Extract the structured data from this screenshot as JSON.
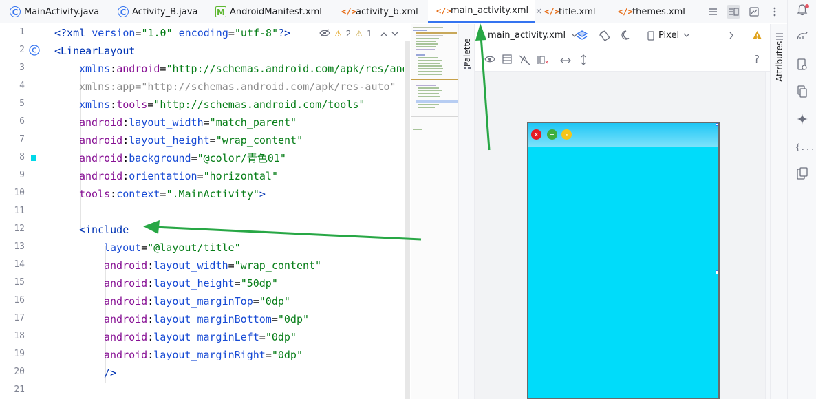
{
  "tabs": [
    {
      "label": "MainActivity.java",
      "icon": "java-class-icon"
    },
    {
      "label": "Activity_B.java",
      "icon": "java-class-icon"
    },
    {
      "label": "AndroidManifest.xml",
      "icon": "manifest-icon"
    },
    {
      "label": "activity_b.xml",
      "icon": "xml-file-icon"
    },
    {
      "label": "main_activity.xml",
      "icon": "xml-file-icon",
      "active": true
    },
    {
      "label": "title.xml",
      "icon": "xml-file-icon"
    },
    {
      "label": "themes.xml",
      "icon": "xml-file-icon"
    }
  ],
  "active_tab_close": "×",
  "inspection": {
    "warnings": "2",
    "weak_warnings": "1"
  },
  "line_numbers": [
    "1",
    "2",
    "3",
    "4",
    "5",
    "6",
    "7",
    "8",
    "9",
    "10",
    "11",
    "12",
    "13",
    "14",
    "15",
    "16",
    "17",
    "18",
    "19",
    "20",
    "21"
  ],
  "code": {
    "l1": {
      "a": "<?xml ",
      "b": "version",
      "c": "=",
      "d": "\"1.0\"",
      "e": " encoding",
      "f": "=",
      "g": "\"utf-8\"",
      "h": "?>"
    },
    "l2": {
      "a": "<LinearLayout"
    },
    "l3": {
      "ns": "xmlns",
      "c": ":",
      "attr": "android",
      "eq": "=",
      "val": "\"http://schemas.android.com/apk/res/andr"
    },
    "l4": {
      "ns": "xmlns",
      "c": ":",
      "attr": "app",
      "eq": "=",
      "val": "\"http://schemas.android.com/apk/res-auto\""
    },
    "l5": {
      "ns": "xmlns",
      "c": ":",
      "attr": "tools",
      "eq": "=",
      "val": "\"http://schemas.android.com/tools\""
    },
    "l6": {
      "ns": "android",
      "c": ":",
      "attr": "layout_width",
      "eq": "=",
      "val": "\"match_parent\""
    },
    "l7": {
      "ns": "android",
      "c": ":",
      "attr": "layout_height",
      "eq": "=",
      "val": "\"wrap_content\""
    },
    "l8": {
      "ns": "android",
      "c": ":",
      "attr": "background",
      "eq": "=",
      "val": "\"@color/青色01\""
    },
    "l9": {
      "ns": "android",
      "c": ":",
      "attr": "orientation",
      "eq": "=",
      "val": "\"horizontal\""
    },
    "l10": {
      "ns": "tools",
      "c": ":",
      "attr": "context",
      "eq": "=",
      "val": "\".MainActivity\"",
      "end": ">"
    },
    "l12": {
      "a": "<include"
    },
    "l13": {
      "attr": "layout",
      "eq": "=",
      "val": "\"@layout/title\""
    },
    "l14": {
      "ns": "android",
      "c": ":",
      "attr": "layout_width",
      "eq": "=",
      "val": "\"wrap_content\""
    },
    "l15": {
      "ns": "android",
      "c": ":",
      "attr": "layout_height",
      "eq": "=",
      "val": "\"50dp\""
    },
    "l16": {
      "ns": "android",
      "c": ":",
      "attr": "layout_marginTop",
      "eq": "=",
      "val": "\"0dp\""
    },
    "l17": {
      "ns": "android",
      "c": ":",
      "attr": "layout_marginBottom",
      "eq": "=",
      "val": "\"0dp\""
    },
    "l18": {
      "ns": "android",
      "c": ":",
      "attr": "layout_marginLeft",
      "eq": "=",
      "val": "\"0dp\""
    },
    "l19": {
      "ns": "android",
      "c": ":",
      "attr": "layout_marginRight",
      "eq": "=",
      "val": "\"0dp\""
    },
    "l20": {
      "a": "/>"
    }
  },
  "palette_label": "Palette",
  "attributes_label": "Attributes",
  "design_toolbar": {
    "file": "main_activity.xml",
    "device": "Pixel",
    "help": "?"
  },
  "device_buttons": {
    "close": "×",
    "max": "+",
    "min": "-"
  },
  "colors": {
    "accent": "#3574f0",
    "preview_bg": "#00dcfa",
    "arrow": "#28a745",
    "gutter_marker": "#00d8e8"
  }
}
